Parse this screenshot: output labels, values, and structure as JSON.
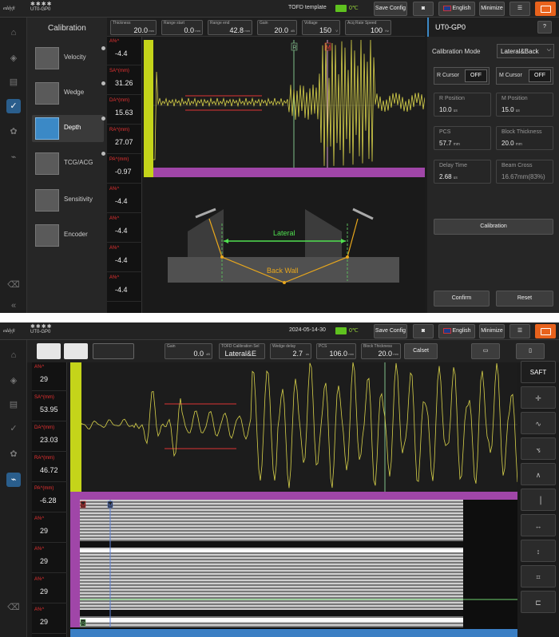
{
  "device": {
    "stars": "✱✱✱✱",
    "name": "UT0-GP0",
    "brand_logo_text": "eddyfi"
  },
  "screen1": {
    "topbar": {
      "template": "TOFD template",
      "temperature": "0℃",
      "save_config": "Save Config",
      "language": "English",
      "minimize": "Minimize"
    },
    "calibration": {
      "title": "Calibration",
      "items": [
        {
          "label": "Velocity",
          "done": true
        },
        {
          "label": "Wedge",
          "done": true
        },
        {
          "label": "Depth",
          "done": true,
          "active": true
        },
        {
          "label": "TCG/ACG",
          "done": true
        },
        {
          "label": "Sensitivity",
          "done": false
        },
        {
          "label": "Encoder",
          "done": false
        }
      ]
    },
    "readouts": [
      {
        "label": "A%^",
        "value": "-4.4"
      },
      {
        "label": "SA^(mm)",
        "value": "31.26"
      },
      {
        "label": "DA^(mm)",
        "value": "15.63"
      },
      {
        "label": "RA^(mm)",
        "value": "27.07"
      },
      {
        "label": "PA^(mm)",
        "value": "-0.97"
      },
      {
        "label": "A%^",
        "value": "-4.4"
      },
      {
        "label": "A%^",
        "value": "-4.4"
      },
      {
        "label": "A%^",
        "value": "-4.4"
      },
      {
        "label": "A%^",
        "value": "-4.4"
      }
    ],
    "params": [
      {
        "label": "Thickness",
        "value": "20.0",
        "unit": "mm"
      },
      {
        "label": "Range start",
        "value": "0.0",
        "unit": "mm"
      },
      {
        "label": "Range end",
        "value": "42.8",
        "unit": "mm"
      },
      {
        "label": "Gain",
        "value": "20.0",
        "unit": "dB"
      },
      {
        "label": "Voltage",
        "value": "150",
        "unit": "V"
      },
      {
        "label": "Acq Rate Speed",
        "value": "100",
        "unit": "Hz"
      }
    ],
    "cursor_labels": {
      "ref": "R",
      "measure": "M"
    },
    "diagram": {
      "lateral": "Lateral",
      "back_wall": "Back Wall"
    },
    "right": {
      "device_title": "UT0-GP0",
      "help": "?",
      "mode_label": "Calibration Mode",
      "mode_value": "Lateral&Back",
      "r_cursor": "R Cursor",
      "r_cursor_state": "OFF",
      "m_cursor": "M Cursor",
      "m_cursor_state": "OFF",
      "fields": [
        {
          "label": "R Position",
          "value": "10.0",
          "unit": "us"
        },
        {
          "label": "M Position",
          "value": "15.0",
          "unit": "us"
        },
        {
          "label": "PCS",
          "value": "57.7",
          "unit": "mm"
        },
        {
          "label": "Block Thickness",
          "value": "20.0",
          "unit": "mm"
        },
        {
          "label": "Delay Time",
          "value": "2.68",
          "unit": "us"
        },
        {
          "label": "Beam Cross",
          "value": "16.67mm(83%)",
          "unit": ""
        }
      ],
      "calibration_button": "Calibration",
      "confirm": "Confirm",
      "reset": "Reset"
    }
  },
  "screen2": {
    "topbar": {
      "date": "2024-05-14-30",
      "temperature": "0℃",
      "save_config": "Save Config",
      "language": "English",
      "minimize": "Minimize"
    },
    "params": [
      {
        "label": "Gain",
        "value": "0.0",
        "unit": "dB"
      },
      {
        "label": "TOFD Calibration Sel",
        "value": "Lateral&E",
        "unit": ""
      },
      {
        "label": "Wedge delay",
        "value": "2.7",
        "unit": "us"
      },
      {
        "label": "PCS",
        "value": "106.0",
        "unit": "mm"
      },
      {
        "label": "Block Thickness",
        "value": "20.0",
        "unit": "mm"
      }
    ],
    "calset": "Calset",
    "readouts": [
      {
        "label": "A%^",
        "value": "29"
      },
      {
        "label": "SA^(mm)",
        "value": "53.95"
      },
      {
        "label": "DA^(mm)",
        "value": "23.03"
      },
      {
        "label": "RA^(mm)",
        "value": "46.72"
      },
      {
        "label": "PA^(mm)",
        "value": "-6.28"
      },
      {
        "label": "A%^",
        "value": "29"
      },
      {
        "label": "A%^",
        "value": "29"
      },
      {
        "label": "A%^",
        "value": "29"
      },
      {
        "label": "A%^",
        "value": "29"
      }
    ],
    "tools": [
      "SAFT",
      "crosshair-tool",
      "wave-tool",
      "ramp-tool",
      "arch-tool",
      "peak-tool",
      "horizontal-arrows-tool",
      "vertical-arrows-tool",
      "crop-tool",
      "probe-tool"
    ],
    "saft_label": "SAFT",
    "cursor_labels": {
      "ref": "R",
      "measure": "M"
    }
  },
  "colors": {
    "accent_yellow": "#c4d41a",
    "magenta": "#a046a8",
    "blue": "#3b89c6",
    "orange": "#e8621c",
    "green": "#5fc21f"
  }
}
